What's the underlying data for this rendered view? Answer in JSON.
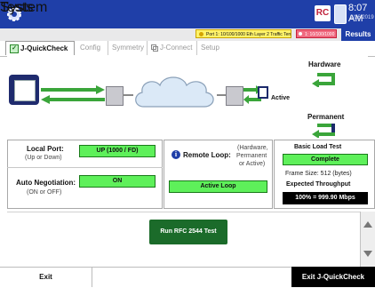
{
  "topbar": {
    "system_label": "System",
    "tests_label": "Tests",
    "time": "8:07 AM",
    "date": "2/26/2019"
  },
  "status": {
    "port_text": "Port 1: 10/100/1000 Eth Layer 2 Traffic Term",
    "rx_text": "1: 10/100/1000",
    "results_label": "Results"
  },
  "tabs": [
    {
      "label": "J-QuickCheck"
    },
    {
      "label": "Config"
    },
    {
      "label": "Symmetry"
    },
    {
      "label": "J-Connect"
    },
    {
      "label": "Setup"
    }
  ],
  "diagram": {
    "hardware_label": "Hardware",
    "permanent_label": "Permanent",
    "active_label": "Active"
  },
  "local_port": {
    "label": "Local Port:",
    "sub": "(Up or Down)",
    "value": "UP (1000 / FD)"
  },
  "auto_neg": {
    "label": "Auto Negotiation:",
    "sub": "(ON or OFF)",
    "value": "ON"
  },
  "remote_loop": {
    "label": "Remote Loop:",
    "sub1": "(Hardware,",
    "sub2": "Permanent",
    "sub3": "or Active)",
    "value": "Active Loop"
  },
  "load_test": {
    "title": "Basic Load Test",
    "status": "Complete",
    "frame_size": "Frame Size: 512 (bytes)",
    "throughput_label": "Expected Throughput",
    "throughput_value": "100% = 999.90 Mbps"
  },
  "actions": {
    "run_rfc": "Run RFC 2544 Test",
    "exit": "Exit",
    "exit_qc": "Exit J-QuickCheck"
  },
  "colors": {
    "topbar": "#1f3fa8",
    "green_status": "#5ef05a",
    "run_button": "#1b6b2a",
    "link_arrow": "#3aa53a"
  }
}
